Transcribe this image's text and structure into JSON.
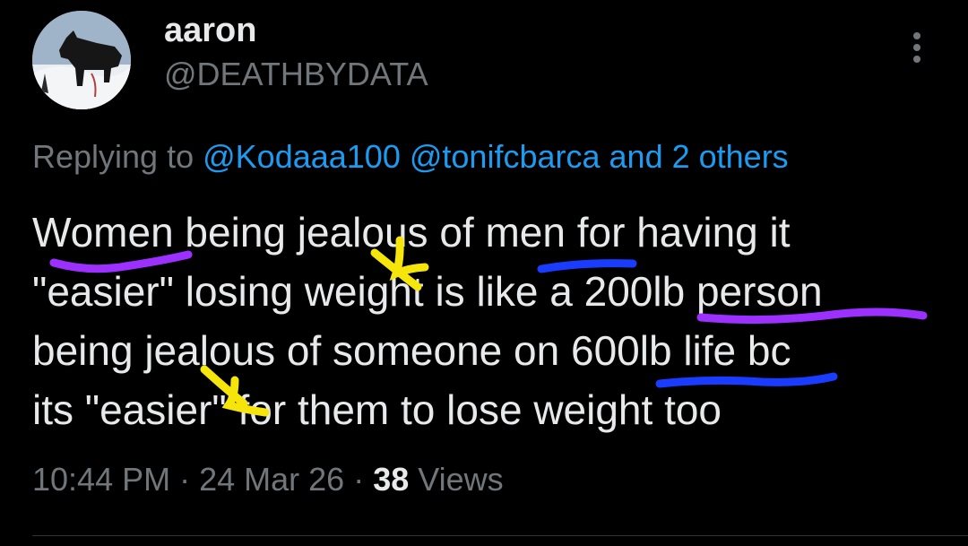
{
  "author": {
    "display_name": "aaron",
    "handle": "@DEATHBYDATA",
    "avatar": "dog-on-snow-avatar"
  },
  "more_icon": "more-vertical-icon",
  "reply": {
    "prefix": "Replying to ",
    "mention_1": "@Kodaaa100",
    "mention_2": "@tonifcbarca",
    "others": "and 2 others"
  },
  "tweet": {
    "lines": [
      "Women being jealous of men for having it",
      "\"easier\" losing weight is like a 200lb person",
      "being jealous of someone on 600lb life bc",
      "its \"easier\" for them to lose weight too"
    ]
  },
  "meta": {
    "time": "10:44 PM",
    "sep1": " · ",
    "date": "24 Mar 26",
    "sep2": " · ",
    "views_count": "38",
    "views_label": " Views"
  },
  "colors": {
    "background": "#000000",
    "text": "#e7e9ea",
    "muted": "#71767b",
    "link": "#1d9bf0",
    "scribble_purple": "#9b30ff",
    "scribble_blue": "#1a3cff",
    "scribble_yellow": "#f5e50a"
  }
}
